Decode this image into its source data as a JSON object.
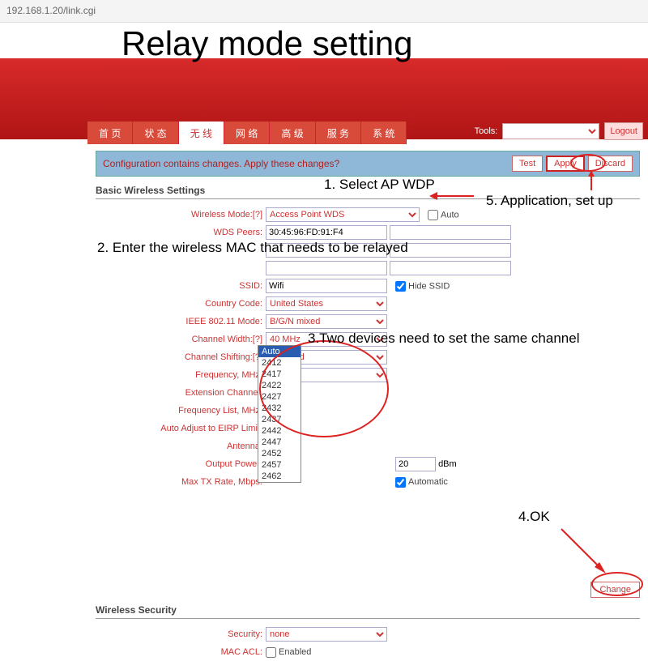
{
  "address_bar": "192.168.1.20/link.cgi",
  "title": "Relay mode setting",
  "nav": {
    "tabs": [
      "首 页",
      "状 态",
      "无 线",
      "网 络",
      "高 级",
      "服 务",
      "系 统"
    ],
    "active_index": 2
  },
  "toolbar": {
    "tools_label": "Tools:",
    "logout": "Logout"
  },
  "notice": {
    "text": "Configuration contains changes. Apply these changes?",
    "test": "Test",
    "apply": "Apply",
    "discard": "Discard"
  },
  "sections": {
    "basic": "Basic Wireless Settings",
    "security": "Wireless Security"
  },
  "form": {
    "wireless_mode": {
      "label": "Wireless Mode:[?]",
      "value": "Access Point WDS",
      "auto": "Auto"
    },
    "wds_peers": {
      "label": "WDS Peers:",
      "value": "30:45:96:FD:91:F4"
    },
    "ssid": {
      "label": "SSID:",
      "value": "Wifi",
      "hide": "Hide SSID"
    },
    "country": {
      "label": "Country Code:",
      "value": "United States"
    },
    "ieee": {
      "label": "IEEE 802.11 Mode:",
      "value": "B/G/N mixed"
    },
    "chwidth": {
      "label": "Channel Width:[?]",
      "value": "40 MHz"
    },
    "chshift": {
      "label": "Channel Shifting:[?]",
      "value": "Disabled"
    },
    "freq": {
      "label": "Frequency, MHz:",
      "value": "Auto",
      "options": [
        "Auto",
        "2412",
        "2417",
        "2422",
        "2427",
        "2432",
        "2437",
        "2442",
        "2447",
        "2452",
        "2457",
        "2462"
      ]
    },
    "extch": {
      "label": "Extension Channel:"
    },
    "freqlist": {
      "label": "Frequency List, MHz:"
    },
    "eirp": {
      "label": "Auto Adjust to EIRP Limit:"
    },
    "antenna": {
      "label": "Antenna:"
    },
    "power": {
      "label": "Output Power:",
      "value": "20",
      "unit": "dBm"
    },
    "maxtx": {
      "label": "Max TX Rate, Mbps:",
      "auto": "Automatic"
    },
    "security": {
      "label": "Security:",
      "value": "none"
    },
    "macacl": {
      "label": "MAC ACL:",
      "enabled": "Enabled"
    }
  },
  "change_btn": "Change",
  "annotations": {
    "a1": "1. Select AP WDP",
    "a2": "2. Enter the wireless MAC that needs to be relayed",
    "a3": "3.Two devices need to set the same channel",
    "a4": "4.OK",
    "a5": "5. Application, set up"
  }
}
